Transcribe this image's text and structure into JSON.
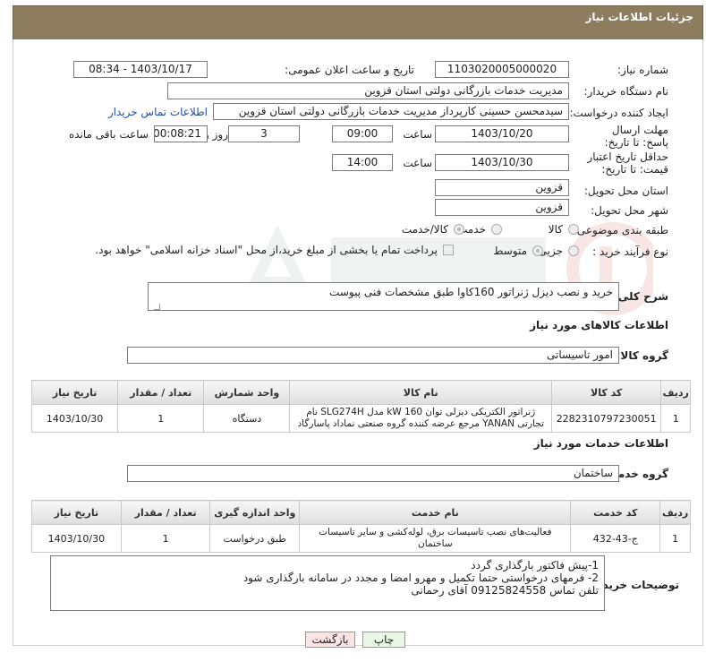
{
  "page": {
    "title": "جزئیات اطلاعات نیاز"
  },
  "form": {
    "need_number_label": "شماره نیاز:",
    "need_number": "1103020005000020",
    "announce_label": "تاریخ و ساعت اعلان عمومی:",
    "announce_value": "1403/10/17 - 08:34",
    "buyer_org_label": "نام دستگاه خریدار:",
    "buyer_org": "مدیریت خدمات بازرگانی دولتی استان قزوین",
    "creator_label": "ایجاد کننده درخواست:",
    "creator": "سیدمحسن  حسینی کارپرداز مدیریت خدمات بازرگانی دولتی استان قزوین",
    "contact_link": "اطلاعات تماس خریدار",
    "deadline_label": "مهلت ارسال پاسخ: تا تاریخ:",
    "deadline_date": "1403/10/20",
    "time_label": "ساعت",
    "deadline_time": "09:00",
    "days_value": "3",
    "days_label": "روز و",
    "remaining_value": "00:08:21",
    "remaining_label": "ساعت باقی مانده",
    "validity_label": "حداقل تاریخ اعتبار قیمت: تا تاریخ:",
    "validity_date": "1403/10/30",
    "validity_time": "14:00",
    "province_label": "استان محل تحویل:",
    "province": "قزوین",
    "city_label": "شهر محل تحویل:",
    "city": "قزوین",
    "category_label": "طبقه بندی موضوعی:",
    "category_options": [
      "کالا",
      "خدمت",
      "کالا/خدمت"
    ],
    "purchase_type_label": "نوع فرآیند خرید :",
    "purchase_options": [
      "جزیی",
      "متوسط"
    ],
    "payment_note": "پرداخت تمام یا بخشی از مبلغ خرید،از محل \"اسناد خزانه اسلامی\" خواهد بود.",
    "description_label": "شرح کلی نیاز:",
    "description": "خرید و نصب دیزل ژنراتور 160کاوا طبق مشخصات فنی پیوست"
  },
  "goods": {
    "section_title": "اطلاعات کالاهای مورد نیاز",
    "group_label": "گروه کالا:",
    "group_value": "امور تاسیساتی",
    "columns": [
      "ردیف",
      "کد کالا",
      "نام کالا",
      "واحد شمارش",
      "تعداد / مقدار",
      "تاریخ نیاز"
    ],
    "rows": [
      {
        "row": "1",
        "code": "2282310797230051",
        "name": "ژنراتور الکتریکی دیزلی توان 160 kW مدل SLG274H نام تجارتی YANAN مرجع عرضه کننده گروه صنعتی نماداد پاسارگاد",
        "unit": "دستگاه",
        "qty": "1",
        "date": "1403/10/30"
      }
    ]
  },
  "services": {
    "section_title": "اطلاعات خدمات مورد نیاز",
    "group_label": "گروه خدمت:",
    "group_value": "ساختمان",
    "columns": [
      "ردیف",
      "کد خدمت",
      "نام خدمت",
      "واحد اندازه گیری",
      "تعداد / مقدار",
      "تاریخ نیاز"
    ],
    "rows": [
      {
        "row": "1",
        "code": "ج-43-432",
        "name": "فعالیت‌های نصب تاسیسات برق، لوله‌کشی و سایر تاسیسات ساختمان",
        "unit": "طبق درخواست",
        "qty": "1",
        "date": "1403/10/30"
      }
    ]
  },
  "notes": {
    "label": "توضیحات خریدار:",
    "line1": "1-پیش فاکتور بارگذاری گردد",
    "line2": "2- فرمهای درخواستی حتما تکمیل و مهرو امضا و مجدد در سامانه بارگذاری شود",
    "line3": "تلفن تماس 09125824558  آقای رحمانی"
  },
  "buttons": {
    "print": "چاپ",
    "back": "بازگشت"
  },
  "colors": {
    "header": "#8d7d5e",
    "print_btn": "#eaf7e4",
    "back_btn": "#fbe4e4"
  }
}
